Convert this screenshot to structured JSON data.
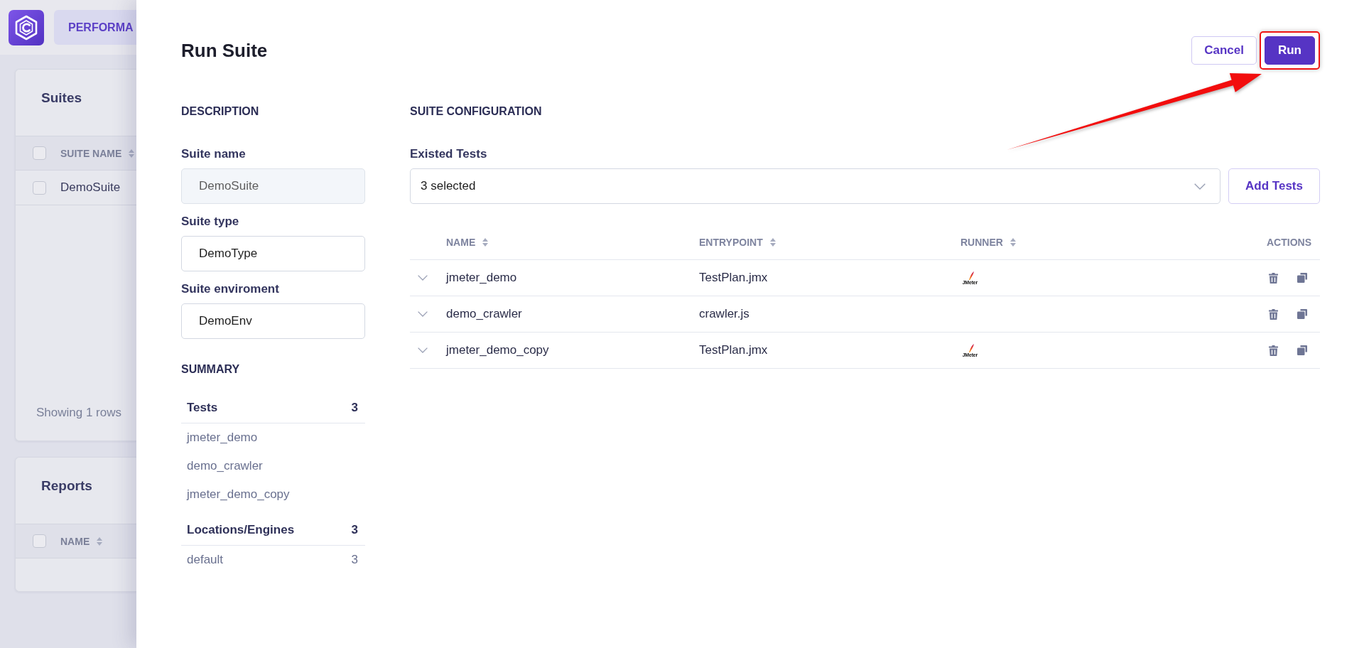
{
  "app_bar": {
    "tab": {
      "label": "PERFORMA",
      "selected": true
    }
  },
  "background_cards": [
    {
      "title": "Suites",
      "select_all": {
        "checked": false
      },
      "columns": [
        {
          "label": "SUITE NAME",
          "sortable": true
        }
      ],
      "rows": [
        {
          "checked": false,
          "cells": [
            "DemoSuite"
          ]
        }
      ],
      "footer": "Showing 1 rows"
    },
    {
      "title": "Reports",
      "select_all": {
        "checked": false
      },
      "columns": [
        {
          "label": "NAME",
          "sortable": true
        }
      ]
    }
  ],
  "dialog": {
    "title": "Run Suite",
    "buttons": [
      {
        "label": "Cancel",
        "kind": "secondary",
        "highlighted": false
      },
      {
        "label": "Run",
        "kind": "primary",
        "highlighted": true
      }
    ],
    "callout": {
      "kind": "arrow"
    },
    "description": {
      "heading": "DESCRIPTION",
      "fields": [
        {
          "label": "Suite name",
          "value": "DemoSuite",
          "disabled": true
        },
        {
          "label": "Suite type",
          "value": "DemoType",
          "disabled": false
        },
        {
          "label": "Suite enviroment",
          "value": "DemoEnv",
          "disabled": false
        }
      ]
    },
    "summary": {
      "heading": "SUMMARY",
      "groups": [
        {
          "label": "Tests",
          "count": "3",
          "items": [
            {
              "label": "jmeter_demo"
            },
            {
              "label": "demo_crawler"
            },
            {
              "label": "jmeter_demo_copy"
            }
          ]
        },
        {
          "label": "Locations/Engines",
          "count": "3",
          "items": [
            {
              "label": "default",
              "count": "3"
            }
          ]
        }
      ]
    },
    "configuration": {
      "heading": "SUITE CONFIGURATION",
      "existed_tests": {
        "label": "Existed Tests",
        "value": "3 selected"
      },
      "add_button": {
        "label": "Add Tests"
      },
      "table": {
        "columns": [
          {
            "label": "NAME",
            "sortable": true
          },
          {
            "label": "ENTRYPOINT",
            "sortable": true
          },
          {
            "label": "RUNNER",
            "sortable": true
          },
          {
            "label": "ACTIONS",
            "sortable": false
          }
        ],
        "rows": [
          {
            "name": "jmeter_demo",
            "entrypoint": "TestPlan.jmx",
            "runner": "JMeter",
            "expanded": false
          },
          {
            "name": "demo_crawler",
            "entrypoint": "crawler.js",
            "expanded": false
          },
          {
            "name": "jmeter_demo_copy",
            "entrypoint": "TestPlan.jmx",
            "runner": "JMeter",
            "expanded": false
          }
        ]
      }
    }
  }
}
